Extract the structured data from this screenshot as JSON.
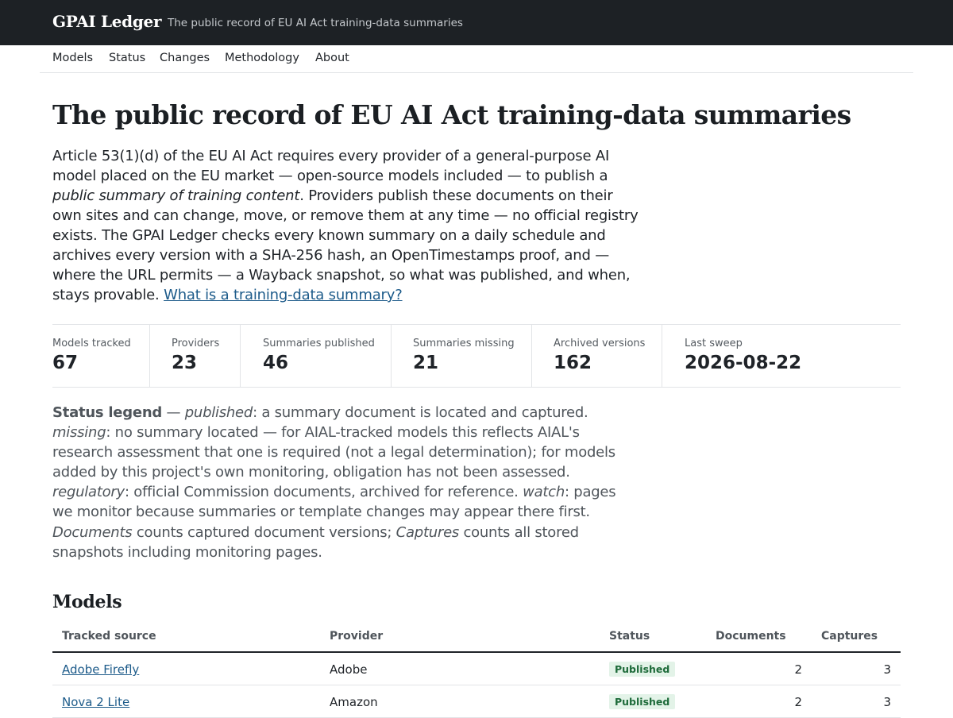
{
  "header": {
    "brand": "GPAI Ledger",
    "tagline": "The public record of EU AI Act training-data summaries"
  },
  "nav": {
    "items": [
      "Models",
      "Status",
      "Changes",
      "Methodology",
      "About"
    ]
  },
  "main": {
    "title": "The public record of EU AI Act training-data summaries",
    "intro": {
      "part1": "Article 53(1)(d) of the EU AI Act requires every provider of a general-purpose AI model placed on the EU market — open-source models included — to publish a ",
      "emphasis": "public summary of training content",
      "part2": ". Providers publish these documents on their own sites and can change, move, or remove them at any time — no official registry exists. The GPAI Ledger checks every known summary on a daily schedule and archives every version with a SHA-256 hash, an OpenTimestamps proof, and — where the URL permits — a Wayback snapshot, so what was published, and when, stays provable. ",
      "link": "What is a training-data summary?"
    },
    "stats": [
      {
        "label": "Models tracked",
        "value": "67"
      },
      {
        "label": "Providers",
        "value": "23"
      },
      {
        "label": "Summaries published",
        "value": "46"
      },
      {
        "label": "Summaries missing",
        "value": "21"
      },
      {
        "label": "Archived versions",
        "value": "162"
      },
      {
        "label": "Last sweep",
        "value": "2026-08-22"
      }
    ],
    "legend": {
      "heading": "Status legend",
      "dash": " — ",
      "published_term": "published",
      "published_text": ": a summary document is located and captured. ",
      "missing_term": "missing",
      "missing_text": ": no summary located — for AIAL-tracked models this reflects AIAL's research assessment that one is required (not a legal determination); for models added by this project's own monitoring, obligation has not been assessed. ",
      "regulatory_term": "regulatory",
      "regulatory_text": ": official Commission documents, archived for reference. ",
      "watch_term": "watch",
      "watch_text": ": pages we monitor because summaries or template changes may appear there first. ",
      "documents_term": "Documents",
      "documents_text": " counts captured document versions; ",
      "captures_term": "Captures",
      "captures_text": " counts all stored snapshots including monitoring pages."
    }
  },
  "models": {
    "title": "Models",
    "columns": [
      "Tracked source",
      "Provider",
      "Status",
      "Documents",
      "Captures"
    ],
    "rows": [
      {
        "source": "Adobe Firefly",
        "provider": "Adobe",
        "status": "Published",
        "documents": "2",
        "captures": "3"
      },
      {
        "source": "Nova 2 Lite",
        "provider": "Amazon",
        "status": "Published",
        "documents": "2",
        "captures": "3"
      }
    ]
  }
}
